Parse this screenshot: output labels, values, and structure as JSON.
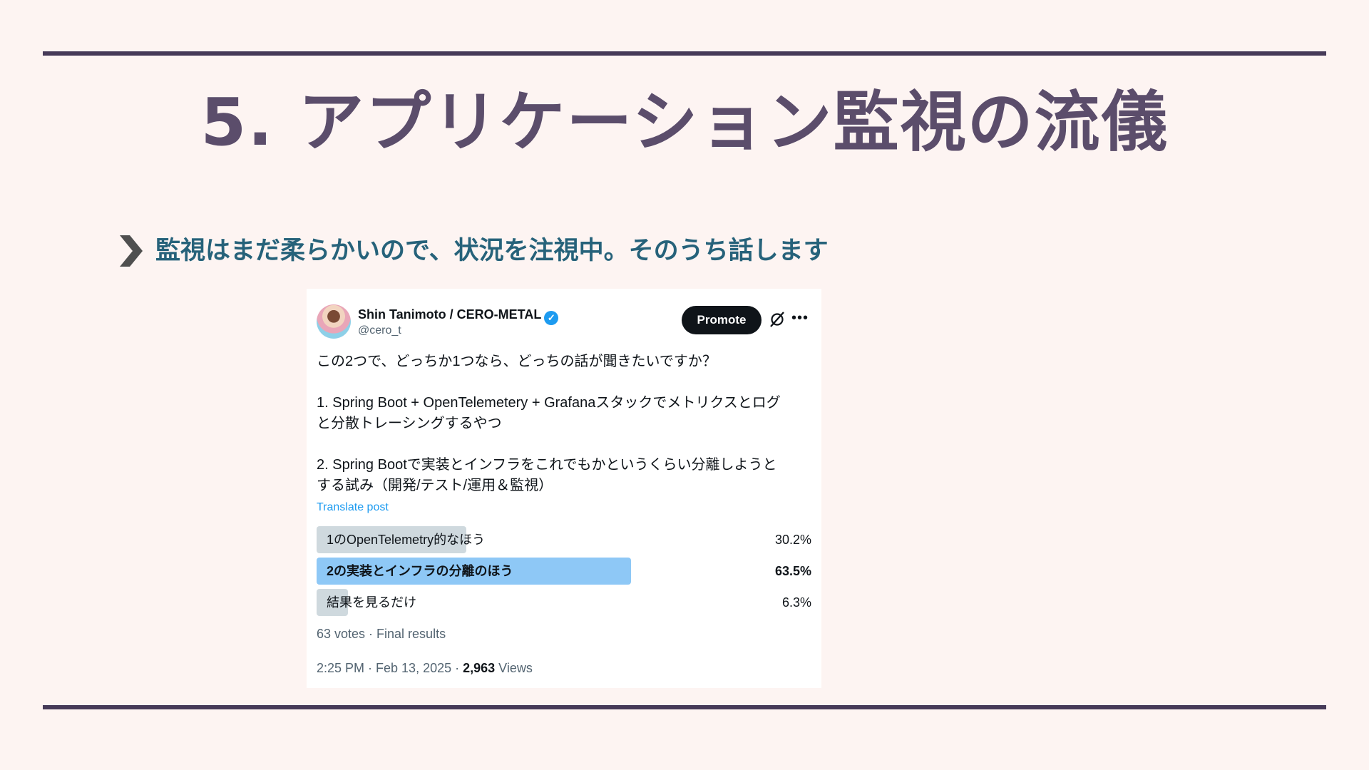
{
  "slide": {
    "title": "5. アプリケーション監視の流儀",
    "bullet": "監視はまだ柔らかいので、状況を注視中。そのうち話します"
  },
  "tweet": {
    "author_name": "Shin Tanimoto / CERO-METAL",
    "handle": "@cero_t",
    "promote_label": "Promote",
    "body_lines": [
      "この2つで、どっちか1つなら、どっちの話が聞きたいですか？",
      "",
      "1. Spring Boot + OpenTelemetery + Grafanaスタックでメトリクスとログ",
      "と分散トレーシングするやつ",
      "",
      "2. Spring Bootで実装とインフラをこれでもかというくらい分離しようと",
      "する試み（開発/テスト/運用＆監視）"
    ],
    "translate_label": "Translate post",
    "poll": [
      {
        "label": "1のOpenTelemetry的なほう",
        "percent_text": "30.2%",
        "fraction": 0.302,
        "winner": false
      },
      {
        "label": "2の実装とインフラの分離のほう",
        "percent_text": "63.5%",
        "fraction": 0.635,
        "winner": true
      },
      {
        "label": "結果を見るだけ",
        "percent_text": "6.3%",
        "fraction": 0.063,
        "winner": false
      }
    ],
    "votes_text": "63 votes · Final results",
    "time_text": "2:25 PM · Feb 13, 2025 · ",
    "views_count": "2,963",
    "views_label": " Views"
  },
  "colors": {
    "background": "#fdf4f2",
    "rule": "#463a58",
    "title": "#5b4d6b",
    "bullet_text": "#26627a",
    "poll_winner": "#8ec8f6",
    "poll_other": "#cfd9de",
    "link": "#1d9bf0"
  }
}
